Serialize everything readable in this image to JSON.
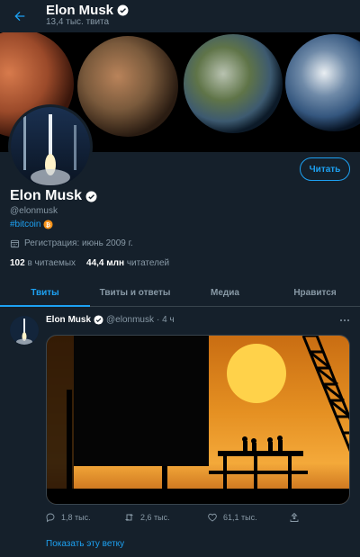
{
  "header": {
    "name": "Elon Musk",
    "tweet_count": "13,4 тыс. твита"
  },
  "profile": {
    "name": "Elon Musk",
    "handle": "@elonmusk",
    "bio_link": "#bitcoin",
    "joined": "Регистрация: июнь 2009 г.",
    "following_count": "102",
    "following_label": "в читаемых",
    "followers_count": "44,4 млн",
    "followers_label": "читателей",
    "follow_button": "Читать"
  },
  "tabs": [
    {
      "label": "Твиты",
      "active": true
    },
    {
      "label": "Твиты и ответы",
      "active": false
    },
    {
      "label": "Медиа",
      "active": false
    },
    {
      "label": "Нравится",
      "active": false
    }
  ],
  "tweet": {
    "name": "Elon Musk",
    "handle": "@elonmusk",
    "time": "· 4 ч",
    "replies": "1,8 тыс.",
    "retweets": "2,6 тыс.",
    "likes": "61,1 тыс.",
    "show_thread": "Показать эту ветку"
  },
  "colors": {
    "background": "#15202b",
    "accent": "#1da1f2",
    "secondary_text": "#8899a6",
    "border": "#38444d"
  },
  "icons": [
    "back-arrow-icon",
    "verified-badge-icon",
    "bitcoin-icon",
    "calendar-icon",
    "more-icon",
    "reply-icon",
    "retweet-icon",
    "like-icon",
    "share-icon"
  ]
}
